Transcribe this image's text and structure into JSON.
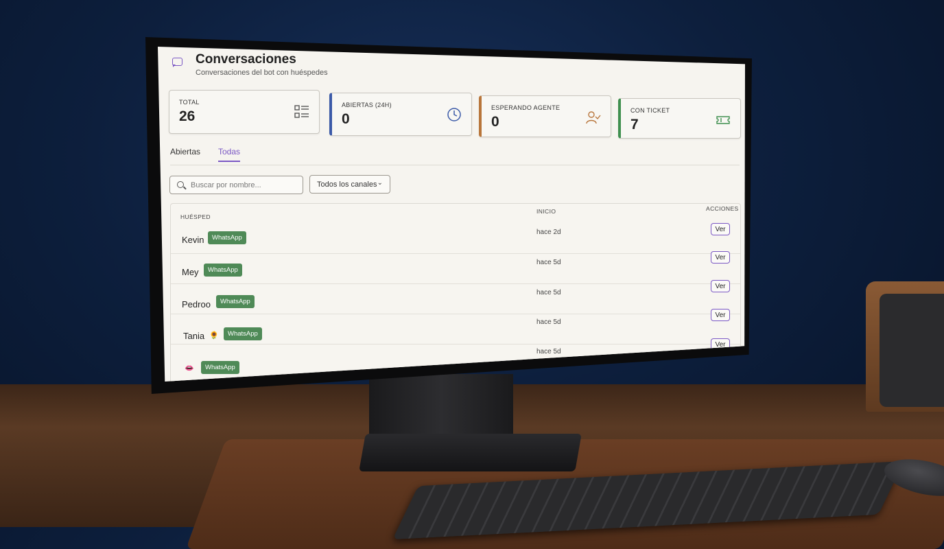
{
  "header": {
    "title": "Conversaciones",
    "subtitle": "Conversaciones del bot con huéspedes"
  },
  "stats": [
    {
      "label": "TOTAL",
      "value": "26",
      "icon": "list-icon",
      "accent": "#c9c6bf"
    },
    {
      "label": "ABIERTAS (24H)",
      "value": "0",
      "icon": "clock-icon",
      "accent": "#3b5aa8"
    },
    {
      "label": "ESPERANDO AGENTE",
      "value": "0",
      "icon": "user-check-icon",
      "accent": "#b8753a"
    },
    {
      "label": "CON TICKET",
      "value": "7",
      "icon": "ticket-icon",
      "accent": "#3f8f4f"
    }
  ],
  "tabs": [
    {
      "label": "Abiertas",
      "active": false
    },
    {
      "label": "Todas",
      "active": true
    }
  ],
  "filters": {
    "search_placeholder": "Buscar por nombre...",
    "channel_selected": "Todos los canales"
  },
  "table": {
    "headers": {
      "guest": "HUÉSPED",
      "start": "INICIO",
      "actions": "ACCIONES"
    },
    "rows": [
      {
        "name": "Kevin",
        "emoji": "",
        "channel": "WhatsApp",
        "start": "hace 2d",
        "action": "Ver"
      },
      {
        "name": "Mey",
        "emoji": "",
        "channel": "WhatsApp",
        "start": "hace 5d",
        "action": "Ver"
      },
      {
        "name": "Pedroo",
        "emoji": "",
        "channel": "WhatsApp",
        "start": "hace 5d",
        "action": "Ver"
      },
      {
        "name": "Tania",
        "emoji": "🌻",
        "channel": "WhatsApp",
        "start": "hace 5d",
        "action": "Ver"
      },
      {
        "name": "",
        "emoji": "👄",
        "channel": "WhatsApp",
        "start": "hace 5d",
        "action": "Ver"
      }
    ]
  },
  "colors": {
    "accent": "#7a57c4",
    "whatsapp_badge": "#4f8a57"
  }
}
